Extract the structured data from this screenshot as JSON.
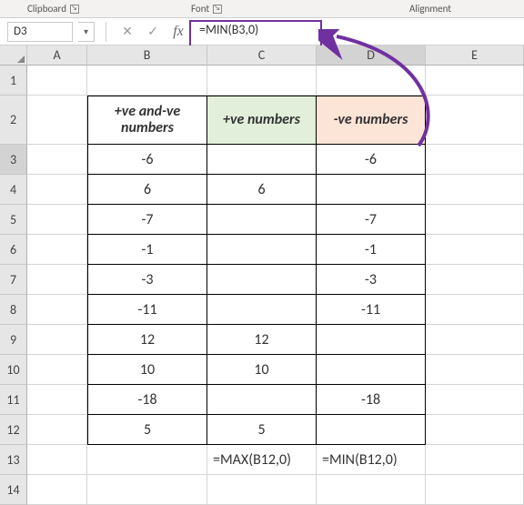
{
  "ribbon": {
    "groups": [
      "Clipboard",
      "Font",
      "Alignment"
    ]
  },
  "namebox": {
    "value": "D3"
  },
  "formula_bar": {
    "cancel": "✕",
    "enter": "✓",
    "fx": "fx",
    "formula": "=MIN(B3,0)"
  },
  "columns": [
    "A",
    "B",
    "C",
    "D",
    "E"
  ],
  "row_numbers": [
    "1",
    "2",
    "3",
    "4",
    "5",
    "6",
    "7",
    "8",
    "9",
    "10",
    "11",
    "12",
    "13",
    "14"
  ],
  "headers": {
    "b2": "+ve and-ve numbers",
    "c2": "+ve numbers",
    "d2": "-ve numbers"
  },
  "chart_data": {
    "type": "table",
    "columns": [
      "+ve and-ve numbers",
      "+ve numbers",
      "-ve numbers"
    ],
    "rows": [
      {
        "b": "-6",
        "c": "",
        "d": "-6"
      },
      {
        "b": "6",
        "c": "6",
        "d": ""
      },
      {
        "b": "-7",
        "c": "",
        "d": "-7"
      },
      {
        "b": "-1",
        "c": "",
        "d": "-1"
      },
      {
        "b": "-3",
        "c": "",
        "d": "-3"
      },
      {
        "b": "-11",
        "c": "",
        "d": "-11"
      },
      {
        "b": "12",
        "c": "12",
        "d": ""
      },
      {
        "b": "10",
        "c": "10",
        "d": ""
      },
      {
        "b": "-18",
        "c": "",
        "d": "-18"
      },
      {
        "b": "5",
        "c": "5",
        "d": ""
      }
    ],
    "formulas": {
      "c13": "=MAX(B12,0)",
      "d13": "=MIN(B12,0)"
    }
  },
  "active_cell": "D3"
}
